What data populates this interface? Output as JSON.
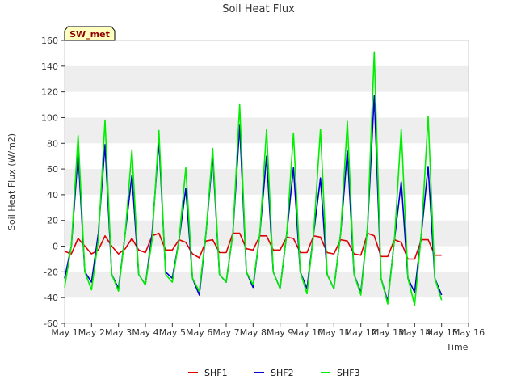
{
  "chart_data": {
    "type": "line",
    "title": "Soil Heat Flux",
    "xlabel": "Time",
    "ylabel": "Soil Heat Flux (W/m2)",
    "xlim": [
      1,
      16
    ],
    "ylim": [
      -60,
      160
    ],
    "x_ticks": [
      1,
      2,
      3,
      4,
      5,
      6,
      7,
      8,
      9,
      10,
      11,
      12,
      13,
      14,
      15,
      16
    ],
    "x_tick_labels": [
      "May 1",
      "May 2",
      "May 3",
      "May 4",
      "May 5",
      "May 6",
      "May 7",
      "May 8",
      "May 9",
      "May 10",
      "May 11",
      "May 12",
      "May 13",
      "May 14",
      "May 15",
      "May 16"
    ],
    "y_ticks": [
      -60,
      -40,
      -20,
      0,
      20,
      40,
      60,
      80,
      100,
      120,
      140,
      160
    ],
    "grid": "horizontal bands",
    "legend_position": "bottom",
    "badge": "SW_met",
    "colors": {
      "SHF1": "#dd0000",
      "SHF2": "#0000cc",
      "SHF3": "#00ee00",
      "band": "#eeeeee",
      "badge_fill": "#ffffc0"
    },
    "series": [
      {
        "name": "SHF1",
        "x": [
          1.0,
          1.25,
          1.5,
          1.75,
          2.0,
          2.25,
          2.5,
          2.75,
          3.0,
          3.25,
          3.5,
          3.75,
          4.0,
          4.25,
          4.5,
          4.75,
          5.0,
          5.25,
          5.5,
          5.75,
          6.0,
          6.25,
          6.5,
          6.75,
          7.0,
          7.25,
          7.5,
          7.75,
          8.0,
          8.25,
          8.5,
          8.75,
          9.0,
          9.25,
          9.5,
          9.75,
          10.0,
          10.25,
          10.5,
          10.75,
          11.0,
          11.25,
          11.5,
          11.75,
          12.0,
          12.25,
          12.5,
          12.75,
          13.0,
          13.25,
          13.5,
          13.75,
          14.0,
          14.25,
          14.5,
          14.75,
          15.0
        ],
        "values": [
          -4,
          -6,
          6,
          0,
          -6,
          -3,
          8,
          0,
          -6,
          -2,
          6,
          -3,
          -5,
          8,
          10,
          -3,
          -3,
          5,
          3,
          -6,
          -9,
          4,
          5,
          -5,
          -5,
          10,
          10,
          -2,
          -3,
          8,
          8,
          -3,
          -3,
          7,
          6,
          -5,
          -5,
          8,
          7,
          -5,
          -6,
          5,
          4,
          -6,
          -7,
          10,
          8,
          -8,
          -8,
          5,
          3,
          -10,
          -10,
          5,
          5,
          -7,
          -7
        ]
      },
      {
        "name": "SHF2",
        "x": [
          1.0,
          1.25,
          1.5,
          1.75,
          2.0,
          2.25,
          2.5,
          2.75,
          3.0,
          3.25,
          3.5,
          3.75,
          4.0,
          4.25,
          4.5,
          4.75,
          5.0,
          5.25,
          5.5,
          5.75,
          6.0,
          6.25,
          6.5,
          6.75,
          7.0,
          7.25,
          7.5,
          7.75,
          8.0,
          8.25,
          8.5,
          8.75,
          9.0,
          9.25,
          9.5,
          9.75,
          10.0,
          10.25,
          10.5,
          10.75,
          11.0,
          11.25,
          11.5,
          11.75,
          12.0,
          12.25,
          12.5,
          12.75,
          13.0,
          13.25,
          13.5,
          13.75,
          14.0,
          14.25,
          14.5,
          14.75,
          15.0
        ],
        "values": [
          -25,
          0,
          72,
          -20,
          -28,
          10,
          79,
          -22,
          -33,
          10,
          55,
          -22,
          -30,
          10,
          82,
          -20,
          -25,
          5,
          45,
          -25,
          -38,
          10,
          70,
          -22,
          -28,
          10,
          94,
          -20,
          -32,
          10,
          70,
          -20,
          -33,
          10,
          61,
          -20,
          -33,
          10,
          53,
          -22,
          -33,
          10,
          74,
          -22,
          -36,
          15,
          117,
          -25,
          -43,
          5,
          50,
          -25,
          -36,
          10,
          62,
          -25,
          -38
        ]
      },
      {
        "name": "SHF3",
        "x": [
          1.0,
          1.25,
          1.5,
          1.75,
          2.0,
          2.25,
          2.5,
          2.75,
          3.0,
          3.25,
          3.5,
          3.75,
          4.0,
          4.25,
          4.5,
          4.75,
          5.0,
          5.25,
          5.5,
          5.75,
          6.0,
          6.25,
          6.5,
          6.75,
          7.0,
          7.25,
          7.5,
          7.75,
          8.0,
          8.25,
          8.5,
          8.75,
          9.0,
          9.25,
          9.5,
          9.75,
          10.0,
          10.25,
          10.5,
          10.75,
          11.0,
          11.25,
          11.5,
          11.75,
          12.0,
          12.25,
          12.5,
          12.75,
          13.0,
          13.25,
          13.5,
          13.75,
          14.0,
          14.25,
          14.5,
          14.75,
          15.0
        ],
        "values": [
          -32,
          0,
          86,
          -20,
          -34,
          5,
          98,
          -22,
          -35,
          10,
          75,
          -22,
          -30,
          5,
          90,
          -22,
          -28,
          5,
          61,
          -25,
          -35,
          10,
          76,
          -22,
          -28,
          10,
          110,
          -20,
          -30,
          10,
          91,
          -20,
          -33,
          10,
          88,
          -20,
          -37,
          10,
          91,
          -22,
          -33,
          10,
          97,
          -22,
          -38,
          15,
          151,
          -25,
          -45,
          5,
          91,
          -25,
          -46,
          10,
          101,
          -25,
          -42
        ]
      }
    ]
  }
}
